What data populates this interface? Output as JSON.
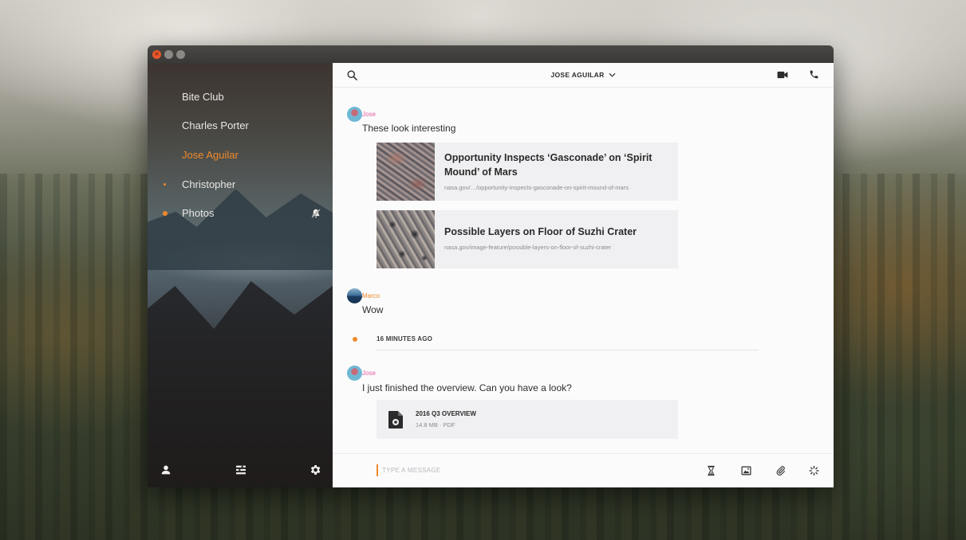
{
  "window": {
    "close_glyph": "×",
    "min_glyph": "–",
    "max_glyph": "□"
  },
  "sidebar": {
    "items": [
      {
        "label": "Bite Club",
        "active": false,
        "indicator": "none"
      },
      {
        "label": "Charles Porter",
        "active": false,
        "indicator": "none"
      },
      {
        "label": "Jose Aguilar",
        "active": true,
        "indicator": "none"
      },
      {
        "label": "Christopher",
        "active": false,
        "indicator": "small-dot"
      },
      {
        "label": "Photos",
        "active": false,
        "indicator": "large-dot",
        "icon": "notifications-off-icon"
      }
    ],
    "footer_icons": [
      "profile-icon",
      "contacts-icon",
      "settings-icon"
    ]
  },
  "header": {
    "contact_name": "JOSE AGUILAR",
    "icons": [
      "search-icon",
      "chevron-down-icon",
      "video-call-icon",
      "phone-icon"
    ]
  },
  "messages": [
    {
      "sender": "Jose",
      "text": "These look interesting",
      "links": [
        {
          "title": "Opportunity Inspects ‘Gasconade’ on ‘Spirit Mound’ of Mars",
          "url": "nasa.gov/…/opportunity-inspects-gasconade-on-spirit-mound-of-mars"
        },
        {
          "title": "Possible Layers on Floor of Suzhi Crater",
          "url": "nasa.gov/image-feature/possible-layers-on-floor-of-suzhi-crater"
        }
      ]
    },
    {
      "sender": "Marco",
      "text": "Wow"
    },
    {
      "sender": "Jose",
      "text": "I just finished the overview. Can you have a look?",
      "file": {
        "name": "2016 Q3 OVERVIEW",
        "info": "14.8 MB · PDF"
      }
    }
  ],
  "divider": {
    "label": "16 MINUTES AGO"
  },
  "composer": {
    "placeholder": "TYPE A MESSAGE",
    "value": "",
    "tools": [
      "timer-icon",
      "image-icon",
      "attachment-icon",
      "loading-icon"
    ]
  },
  "colors": {
    "accent": "#ee8a2c",
    "jose": "#e55ca0",
    "marco": "#ee8a2c",
    "close_button": "#e8572a"
  }
}
